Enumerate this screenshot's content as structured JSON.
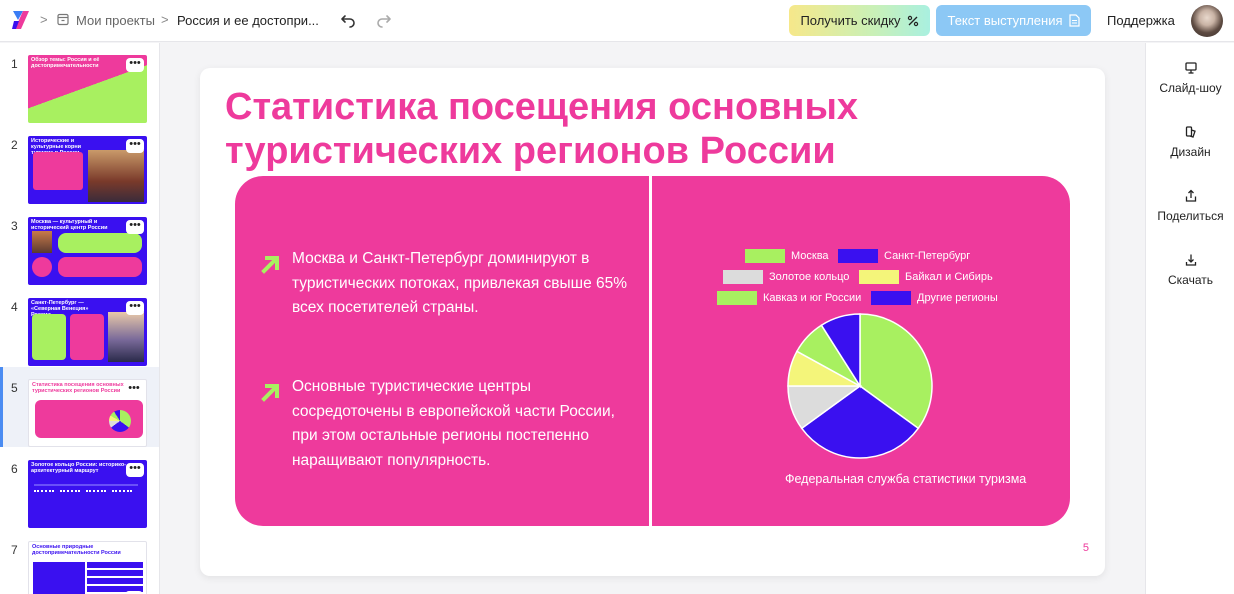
{
  "header": {
    "crumb_sep": ">",
    "projects_label": "Мои проекты",
    "doc_title": "Россия и ее достопри...",
    "discount_label": "Получить скидку",
    "discount_icon": "percent-icon",
    "speech_label": "Текст выступления",
    "speech_icon": "document-icon",
    "support_label": "Поддержка"
  },
  "colors": {
    "brand_pink": "#ee3a9c",
    "accent_green": "#a8f060",
    "accent_purple": "#3a10f0",
    "active_blue": "#4b8cf2"
  },
  "sidebar": {
    "more_glyph": "•••",
    "thumbnails": [
      {
        "num": "1",
        "title": "Обзор темы: Россия и её достопримечательности"
      },
      {
        "num": "2",
        "title": "Исторические и культурные корни туризма в России"
      },
      {
        "num": "3",
        "title": "Москва — культурный и исторический центр России"
      },
      {
        "num": "4",
        "title": "Санкт-Петербург — «Северная Венеция» России"
      },
      {
        "num": "5",
        "title": "Статистика посещения основных туристических регионов России"
      },
      {
        "num": "6",
        "title": "Золотое кольцо России: историко-архитектурный маршрут"
      },
      {
        "num": "7",
        "title": "Основные природные достопримечательности России"
      }
    ]
  },
  "right_panel": {
    "slideshow_label": "Слайд-шоу",
    "design_label": "Дизайн",
    "share_label": "Поделиться",
    "download_label": "Скачать"
  },
  "slide": {
    "title": "Статистика посещения основных туристических регионов России",
    "bullet1": "Москва и Санкт-Петербург доминируют в туристических потоках, привлекая свыше 65% всех посетителей страны.",
    "bullet2": "Основные туристические центры сосредоточены в европейской части России, при этом остальные регионы постепенно наращивают популярность.",
    "source": "Федеральная служба статистики туризма",
    "number": "5"
  },
  "chart_data": {
    "type": "pie",
    "title": "",
    "legend_placement": "top",
    "series": [
      {
        "name": "Москва",
        "value": 35,
        "color": "#a8f060"
      },
      {
        "name": "Санкт-Петербург",
        "value": 30,
        "color": "#3a10f0"
      },
      {
        "name": "Золотое кольцо",
        "value": 10,
        "color": "#dcdcdc"
      },
      {
        "name": "Байкал и Сибирь",
        "value": 8,
        "color": "#f4f57a"
      },
      {
        "name": "Кавказ и юг России",
        "value": 8,
        "color": "#a8f060"
      },
      {
        "name": "Другие регионы",
        "value": 9,
        "color": "#3a10f0"
      }
    ]
  }
}
